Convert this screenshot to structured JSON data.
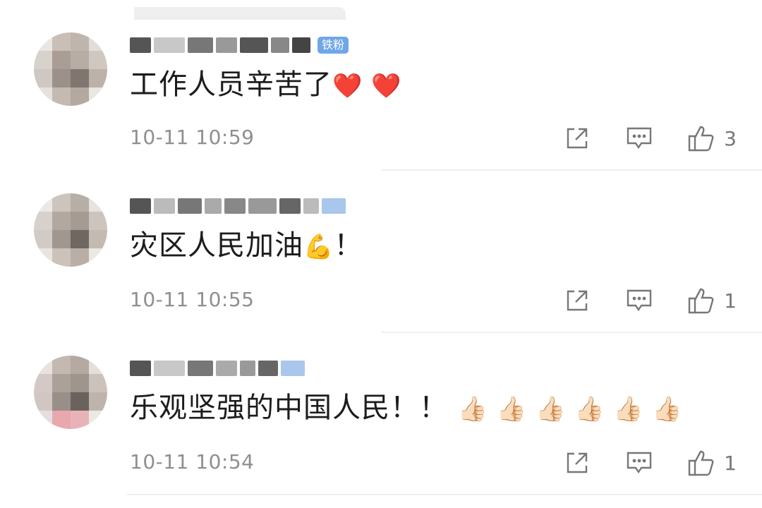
{
  "comments": [
    {
      "badge": "铁粉",
      "text": "工作人员辛苦了",
      "emoji": "❤️ ❤️",
      "time": "10-11 10:59",
      "likes": "3"
    },
    {
      "badge": "",
      "text": "灾区人民加油",
      "emoji": "💪",
      "suffix": "！",
      "time": "10-11 10:55",
      "likes": "1"
    },
    {
      "badge": "",
      "text": "乐观坚强的中国人民！！",
      "emoji": "👍🏻 👍🏻 👍🏻 👍🏻 👍🏻 👍🏻",
      "time": "10-11 10:54",
      "likes": "1"
    }
  ],
  "icons": {
    "share": "share-icon",
    "comment": "comment-icon",
    "like": "thumbs-up-icon"
  },
  "colors": {
    "badge": "#6fa6e8",
    "time": "#8f8f8f",
    "separator": "#f0f0f0"
  }
}
